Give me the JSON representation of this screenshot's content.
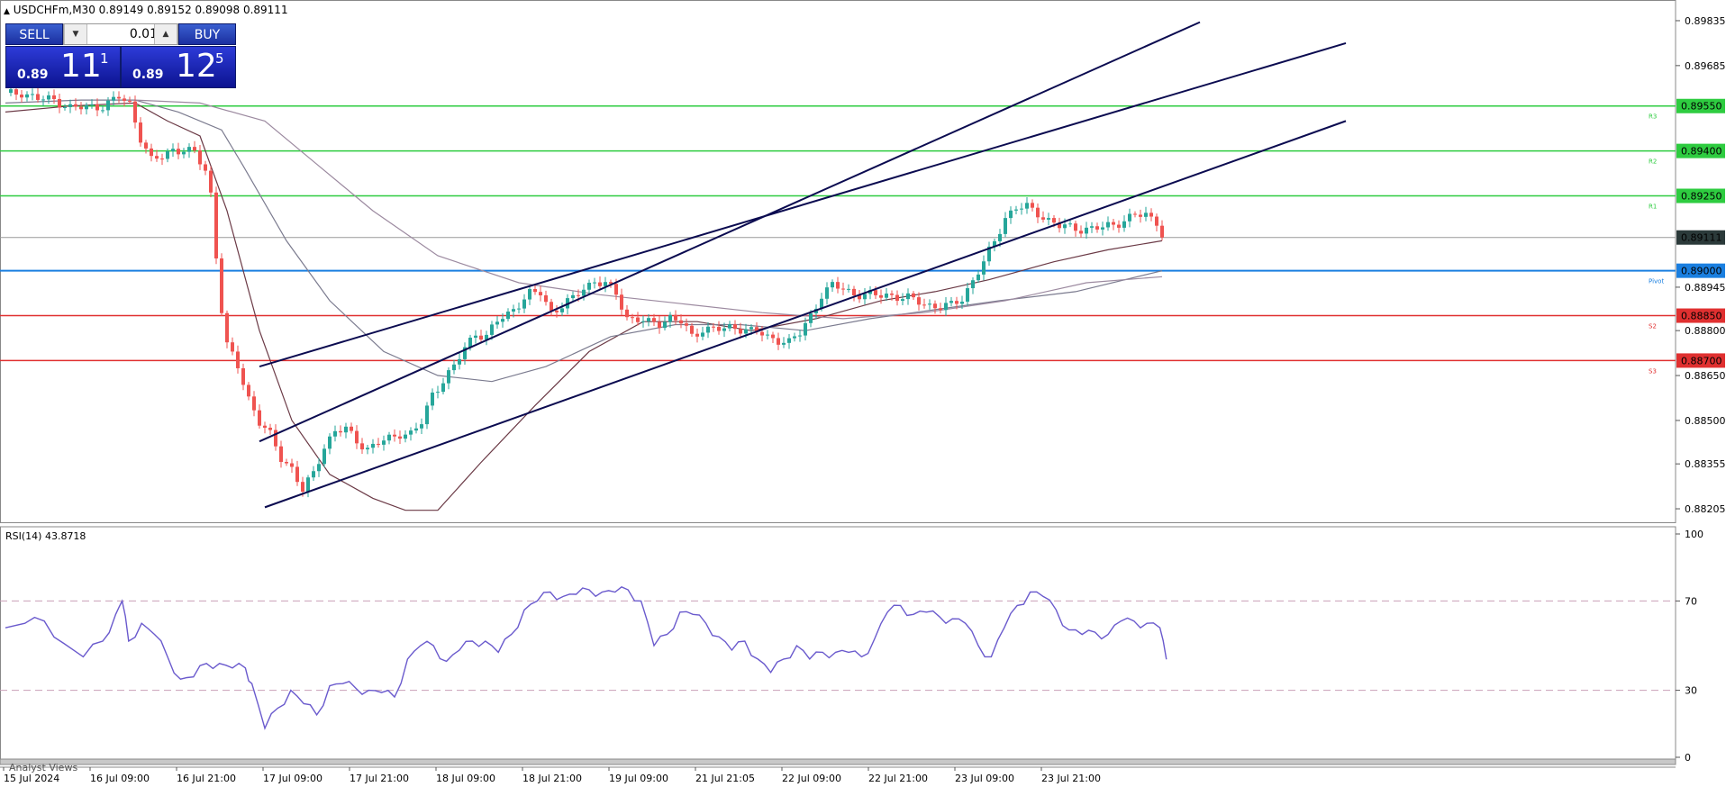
{
  "header": {
    "triangle_icon": "triangle-up-icon",
    "text": "USDCHFm,M30  0.89149 0.89152 0.89098 0.89111"
  },
  "trade_panel": {
    "sell_label": "SELL",
    "buy_label": "BUY",
    "lot": "0.01",
    "sell_small": "0.89",
    "sell_big": "11",
    "sell_sup": "1",
    "buy_small": "0.89",
    "buy_big": "12",
    "buy_sup": "5"
  },
  "chart_data": [
    {
      "type": "candlestick",
      "symbol": "USDCHFm",
      "timeframe": "M30",
      "ylim": [
        0.8816,
        0.8988
      ],
      "y_ticks": [
        0.89835,
        0.89685,
        0.88945,
        0.888,
        0.8865,
        0.885,
        0.88355,
        0.88205
      ],
      "x_ticks": [
        "15 Jul 2024",
        "16 Jul 09:00",
        "16 Jul 21:00",
        "17 Jul 09:00",
        "17 Jul 21:00",
        "18 Jul 09:00",
        "18 Jul 21:00",
        "19 Jul 09:00",
        "21 Jul 21:05",
        "22 Jul 09:00",
        "22 Jul 21:00",
        "23 Jul 09:00",
        "23 Jul 21:00"
      ],
      "current_price": 0.89111,
      "current_price_label": "0.89111",
      "colors": {
        "bull": "#26a69a",
        "bear": "#ef5350",
        "channel": "#0b0b50",
        "resistance": "#2ecc40",
        "pivot": "#1a7fe0",
        "support": "#e03030"
      },
      "close_path": [
        [
          0,
          0.89588
        ],
        [
          3,
          0.89595
        ],
        [
          6,
          0.89575
        ],
        [
          9,
          0.8957
        ],
        [
          12,
          0.89545
        ],
        [
          15,
          0.89545
        ],
        [
          18,
          0.8955
        ],
        [
          21,
          0.8958
        ],
        [
          23,
          0.89555
        ],
        [
          25,
          0.89445
        ],
        [
          27,
          0.89368
        ],
        [
          29,
          0.8938
        ],
        [
          31,
          0.89405
        ],
        [
          33,
          0.89403
        ],
        [
          35,
          0.89393
        ],
        [
          37,
          0.89335
        ],
        [
          38,
          0.89255
        ],
        [
          39,
          0.8905
        ],
        [
          40,
          0.8887
        ],
        [
          41,
          0.8875
        ],
        [
          43,
          0.8868
        ],
        [
          45,
          0.88575
        ],
        [
          47,
          0.88495
        ],
        [
          49,
          0.8845
        ],
        [
          51,
          0.88375
        ],
        [
          53,
          0.8834
        ],
        [
          55,
          0.88266
        ],
        [
          57,
          0.88322
        ],
        [
          59,
          0.88414
        ],
        [
          61,
          0.88465
        ],
        [
          63,
          0.8847
        ],
        [
          65,
          0.88432
        ],
        [
          67,
          0.88405
        ],
        [
          69,
          0.88425
        ],
        [
          71,
          0.88438
        ],
        [
          73,
          0.88457
        ],
        [
          75,
          0.88455
        ],
        [
          77,
          0.88492
        ],
        [
          79,
          0.88587
        ],
        [
          81,
          0.88635
        ],
        [
          83,
          0.88679
        ],
        [
          85,
          0.88742
        ],
        [
          87,
          0.88792
        ],
        [
          89,
          0.8878
        ],
        [
          91,
          0.88832
        ],
        [
          93,
          0.88856
        ],
        [
          95,
          0.8889
        ],
        [
          97,
          0.88922
        ],
        [
          99,
          0.88927
        ],
        [
          101,
          0.88862
        ],
        [
          103,
          0.88883
        ],
        [
          105,
          0.88906
        ],
        [
          107,
          0.88943
        ],
        [
          109,
          0.88965
        ],
        [
          111,
          0.88955
        ],
        [
          113,
          0.88923
        ],
        [
          115,
          0.88843
        ],
        [
          117,
          0.88838
        ],
        [
          119,
          0.88825
        ],
        [
          121,
          0.88824
        ],
        [
          123,
          0.88845
        ],
        [
          125,
          0.8883
        ],
        [
          127,
          0.88778
        ],
        [
          129,
          0.88806
        ],
        [
          131,
          0.88808
        ],
        [
          133,
          0.88803
        ],
        [
          135,
          0.88811
        ],
        [
          137,
          0.88804
        ],
        [
          139,
          0.88798
        ],
        [
          141,
          0.88775
        ],
        [
          143,
          0.8877
        ],
        [
          145,
          0.88762
        ],
        [
          147,
          0.8879
        ],
        [
          149,
          0.8885
        ],
        [
          151,
          0.8892
        ],
        [
          153,
          0.8895
        ],
        [
          155,
          0.8894
        ],
        [
          157,
          0.88922
        ],
        [
          159,
          0.8892
        ],
        [
          161,
          0.88917
        ],
        [
          163,
          0.8892
        ],
        [
          165,
          0.88913
        ],
        [
          167,
          0.88908
        ],
        [
          169,
          0.88897
        ],
        [
          171,
          0.88884
        ],
        [
          173,
          0.88879
        ],
        [
          175,
          0.88884
        ],
        [
          177,
          0.88908
        ],
        [
          179,
          0.88967
        ],
        [
          181,
          0.89028
        ],
        [
          183,
          0.89098
        ],
        [
          185,
          0.89178
        ],
        [
          187,
          0.8921
        ],
        [
          189,
          0.89212
        ],
        [
          191,
          0.89193
        ],
        [
          193,
          0.89168
        ],
        [
          195,
          0.89149
        ],
        [
          197,
          0.89145
        ],
        [
          199,
          0.8914
        ],
        [
          201,
          0.89139
        ],
        [
          203,
          0.89145
        ],
        [
          205,
          0.89155
        ],
        [
          207,
          0.89168
        ],
        [
          209,
          0.89185
        ],
        [
          211,
          0.89186
        ],
        [
          213,
          0.89165
        ],
        [
          214,
          0.89111
        ]
      ],
      "moving_averages": [
        {
          "color": "#6b3a46",
          "points": [
            [
              0,
              0.8953
            ],
            [
              12,
              0.8955
            ],
            [
              24,
              0.8956
            ],
            [
              30,
              0.895
            ],
            [
              36,
              0.8945
            ],
            [
              41,
              0.892
            ],
            [
              47,
              0.888
            ],
            [
              53,
              0.885
            ],
            [
              60,
              0.8832
            ],
            [
              68,
              0.8824
            ],
            [
              74,
              0.882
            ],
            [
              80,
              0.882
            ],
            [
              88,
              0.8836
            ],
            [
              98,
              0.8855
            ],
            [
              108,
              0.8873
            ],
            [
              118,
              0.8883
            ],
            [
              128,
              0.8883
            ],
            [
              138,
              0.888
            ],
            [
              150,
              0.8884
            ],
            [
              162,
              0.889
            ],
            [
              172,
              0.8893
            ],
            [
              182,
              0.8897
            ],
            [
              194,
              0.8903
            ],
            [
              204,
              0.8907
            ],
            [
              214,
              0.891
            ]
          ]
        },
        {
          "color": "#7b7b8f",
          "points": [
            [
              0,
              0.8956
            ],
            [
              14,
              0.8957
            ],
            [
              24,
              0.8957
            ],
            [
              32,
              0.8953
            ],
            [
              40,
              0.8947
            ],
            [
              44,
              0.8935
            ],
            [
              52,
              0.891
            ],
            [
              60,
              0.889
            ],
            [
              70,
              0.8873
            ],
            [
              80,
              0.8865
            ],
            [
              90,
              0.8863
            ],
            [
              100,
              0.8868
            ],
            [
              112,
              0.8878
            ],
            [
              124,
              0.8882
            ],
            [
              136,
              0.8882
            ],
            [
              148,
              0.888
            ],
            [
              160,
              0.8884
            ],
            [
              172,
              0.8887
            ],
            [
              184,
              0.889
            ],
            [
              198,
              0.8893
            ],
            [
              214,
              0.89
            ]
          ]
        },
        {
          "color": "#9c8aa0",
          "points": [
            [
              24,
              0.8957
            ],
            [
              36,
              0.8956
            ],
            [
              48,
              0.895
            ],
            [
              58,
              0.8935
            ],
            [
              68,
              0.892
            ],
            [
              80,
              0.8905
            ],
            [
              95,
              0.8896
            ],
            [
              110,
              0.8892
            ],
            [
              125,
              0.8889
            ],
            [
              140,
              0.8886
            ],
            [
              155,
              0.8884
            ],
            [
              170,
              0.8886
            ],
            [
              185,
              0.889
            ],
            [
              200,
              0.8896
            ],
            [
              214,
              0.8898
            ]
          ]
        }
      ],
      "levels": [
        {
          "price": 0.8955,
          "label": "0.89550",
          "tag": "R3",
          "kind": "resistance"
        },
        {
          "price": 0.894,
          "label": "0.89400",
          "tag": "R2",
          "kind": "resistance"
        },
        {
          "price": 0.8925,
          "label": "0.89250",
          "tag": "R1",
          "kind": "resistance"
        },
        {
          "price": 0.89,
          "label": "0.89000",
          "tag": "Pivot",
          "kind": "pivot"
        },
        {
          "price": 0.8885,
          "label": "0.88850",
          "tag": "S2",
          "kind": "support"
        },
        {
          "price": 0.887,
          "label": "0.88700",
          "tag": "S3",
          "kind": "support"
        }
      ],
      "channels": [
        {
          "from": [
            47,
            0.8843
          ],
          "to": [
            221,
            0.8983
          ]
        },
        {
          "from": [
            47,
            0.8868
          ],
          "to": [
            248,
            0.8976
          ]
        },
        {
          "from": [
            48,
            0.8821
          ],
          "to": [
            248,
            0.895
          ]
        }
      ]
    },
    {
      "type": "line",
      "title": "RSI(14) 43.8718",
      "ylim": [
        0,
        100
      ],
      "y_ticks": [
        100,
        70,
        30,
        0
      ],
      "guide_levels": [
        70,
        30
      ],
      "values": [
        [
          0,
          58
        ],
        [
          3,
          60
        ],
        [
          6,
          61
        ],
        [
          9,
          51
        ],
        [
          12,
          45
        ],
        [
          15,
          52
        ],
        [
          17,
          64
        ],
        [
          18,
          70
        ],
        [
          19,
          52
        ],
        [
          21,
          60
        ],
        [
          23,
          55
        ],
        [
          25,
          45
        ],
        [
          27,
          35
        ],
        [
          29,
          36
        ],
        [
          31,
          42
        ],
        [
          33,
          42
        ],
        [
          35,
          40
        ],
        [
          37,
          40
        ],
        [
          38,
          33
        ],
        [
          40,
          13
        ],
        [
          42,
          22
        ],
        [
          44,
          30
        ],
        [
          46,
          24
        ],
        [
          48,
          19
        ],
        [
          50,
          32
        ],
        [
          52,
          33
        ],
        [
          54,
          31
        ],
        [
          56,
          30
        ],
        [
          58,
          29
        ],
        [
          60,
          27
        ],
        [
          62,
          44
        ],
        [
          64,
          50
        ],
        [
          66,
          50
        ],
        [
          68,
          43
        ],
        [
          70,
          48
        ],
        [
          72,
          52
        ],
        [
          74,
          52
        ],
        [
          76,
          47
        ],
        [
          78,
          55
        ],
        [
          80,
          66
        ],
        [
          82,
          70
        ],
        [
          84,
          74
        ],
        [
          86,
          72
        ],
        [
          88,
          73
        ],
        [
          90,
          75
        ],
        [
          92,
          74
        ],
        [
          94,
          74
        ],
        [
          96,
          75
        ],
        [
          98,
          70
        ],
        [
          100,
          50
        ],
        [
          102,
          55
        ],
        [
          104,
          65
        ],
        [
          106,
          64
        ],
        [
          108,
          60
        ],
        [
          110,
          54
        ],
        [
          112,
          48
        ],
        [
          114,
          52
        ],
        [
          116,
          44
        ],
        [
          118,
          38
        ],
        [
          120,
          44
        ],
        [
          122,
          50
        ],
        [
          124,
          44
        ],
        [
          126,
          47
        ],
        [
          128,
          47
        ],
        [
          130,
          47
        ],
        [
          132,
          45
        ],
        [
          134,
          53
        ],
        [
          136,
          65
        ],
        [
          138,
          68
        ],
        [
          140,
          64
        ],
        [
          142,
          65
        ],
        [
          144,
          63
        ],
        [
          146,
          62
        ],
        [
          148,
          60
        ],
        [
          150,
          50
        ],
        [
          152,
          45
        ],
        [
          154,
          58
        ],
        [
          156,
          68
        ],
        [
          158,
          74
        ],
        [
          160,
          72
        ],
        [
          162,
          66
        ],
        [
          164,
          57
        ],
        [
          166,
          55
        ],
        [
          168,
          56
        ],
        [
          170,
          55
        ],
        [
          172,
          61
        ],
        [
          174,
          61
        ],
        [
          176,
          60
        ],
        [
          178,
          58
        ],
        [
          179,
          43.8718
        ]
      ],
      "colors": {
        "line": "#6a5acd",
        "guide": "#c9a0b8"
      }
    }
  ],
  "footer": {
    "tab": "Analyst Views"
  }
}
